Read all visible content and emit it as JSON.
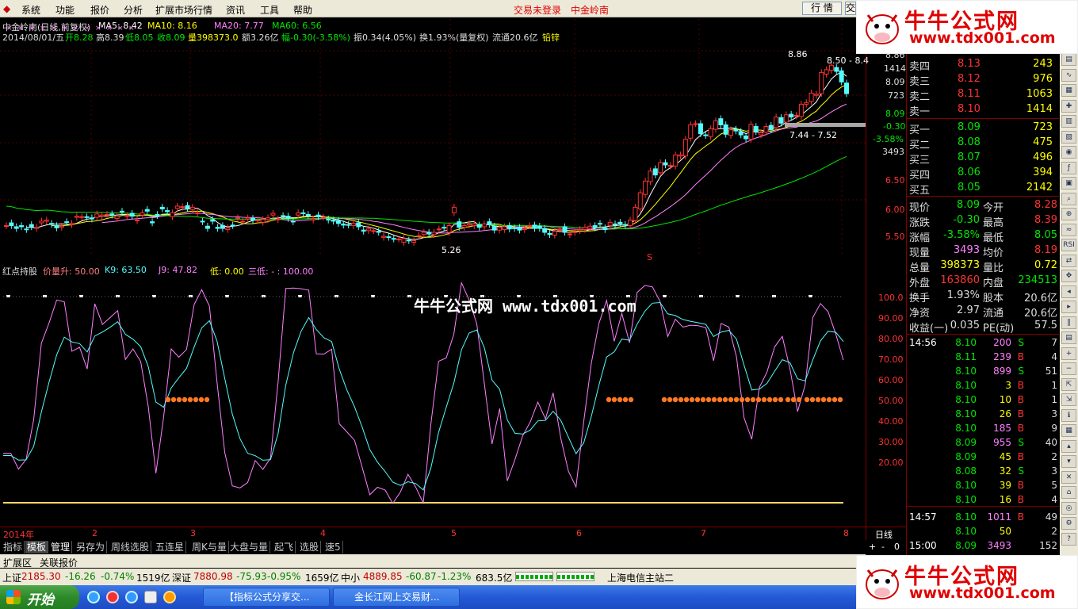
{
  "menubar": {
    "items": [
      "系统",
      "功能",
      "报价",
      "分析",
      "扩展市场行情",
      "资讯",
      "工具",
      "帮助"
    ],
    "center": [
      "交易未登录",
      "中金岭南"
    ],
    "dock_button": "行 情"
  },
  "chart": {
    "header1": [
      "中金岭南(日线,前复权)",
      "MA5: 8.42",
      "MA10: 8.16",
      "MA20: 7.77",
      "MA60: 6.56"
    ],
    "header2": [
      "2014/08/01/五",
      "开8.28",
      "高8.39",
      "低8.05",
      "收8.09",
      "量398373.0",
      "额3.26亿",
      "幅-0.30(-3.58%)",
      "振0.34(4.05%)",
      "换1.93%(量复权)",
      "流通20.6亿",
      "铅锌"
    ],
    "price_axis": [
      "8.86",
      "1414",
      "8.09",
      "723",
      "8.09",
      "-0.30",
      "-3.58%",
      "3493",
      "6.50",
      "6.00",
      "5.50"
    ],
    "annotations": [
      "8.86",
      "8.50 - 8.4",
      "7.44 - 7.52",
      "5.26",
      "S"
    ],
    "ind_header": [
      "红点持股",
      "价量升: 50.00",
      "K9: 63.50",
      "J9: 47.82",
      "低: 0.00",
      "三低: - : 100.00"
    ],
    "ind_axis": [
      "100.0",
      "90.00",
      "80.00",
      "70.00",
      "60.00",
      "50.00",
      "40.00",
      "30.00",
      "20.00"
    ],
    "x_axis": [
      "2014年",
      "2",
      "3",
      "4",
      "5",
      "6",
      "7",
      "8"
    ],
    "period": "日线",
    "zoom": [
      "+",
      "-",
      "0"
    ],
    "watermark": "牛牛公式网 www.tdx001.com",
    "candles": {
      "o": [
        5.72,
        5.77,
        5.7,
        5.72,
        5.66,
        5.74,
        5.67,
        5.77,
        5.8,
        5.76,
        5.72,
        5.69,
        5.79,
        5.74,
        5.87,
        5.87,
        5.88,
        5.86,
        5.87,
        5.89,
        5.92,
        5.93,
        5.85,
        5.98,
        5.89,
        5.94,
        5.81,
        5.91,
        6.01,
        5.79,
        5.92,
        6.05,
        5.99,
        5.88,
        6.03,
        6.05,
        6.08,
        6.01,
        5.94,
        5.8,
        5.71,
        5.83,
        5.69,
        5.72,
        5.65,
        5.73,
        5.85,
        5.8,
        5.84,
        5.85,
        5.81,
        5.78,
        5.83,
        5.91,
        5.83,
        5.9,
        5.89,
        5.8,
        5.91,
        5.95,
        5.92,
        5.82,
        5.91,
        5.87,
        5.84,
        5.82,
        5.81,
        5.75,
        5.74,
        5.72,
        5.77,
        5.64,
        5.63,
        5.63,
        5.62,
        5.51,
        5.52,
        5.49,
        5.48,
        5.42,
        5.46,
        5.42,
        5.54,
        5.56,
        5.6,
        5.56,
        5.66,
        5.69,
        5.6,
        5.95,
        5.79,
        5.69,
        5.73,
        5.72,
        5.73,
        5.7,
        5.79,
        5.71,
        5.64,
        5.65,
        5.72,
        5.68,
        5.69,
        5.65,
        5.72,
        5.73,
        5.71,
        5.67,
        5.58,
        5.55,
        5.65,
        5.7,
        5.56,
        5.6,
        5.63,
        5.65,
        5.67,
        5.72,
        5.76,
        5.68,
        5.72,
        5.75,
        5.78,
        5.74,
        5.72,
        5.81,
        6.02,
        6.28,
        6.51,
        6.74,
        6.67,
        6.85,
        6.79,
        6.79,
        6.97,
        6.97,
        7.29,
        7.55,
        7.55,
        7.35,
        7.32,
        7.45,
        7.64,
        7.53,
        7.34,
        7.45,
        7.41,
        7.33,
        7.27,
        7.5,
        7.35,
        7.4,
        7.52,
        7.48,
        7.66,
        7.58,
        7.72,
        7.69,
        7.68,
        7.9,
        7.95,
        8.06,
        8.09,
        8.44,
        8.51,
        8.56,
        8.5,
        8.28
      ],
      "c": [
        5.72,
        5.72,
        5.67,
        5.7,
        5.65,
        5.7,
        5.69,
        5.8,
        5.82,
        5.74,
        5.68,
        5.71,
        5.78,
        5.76,
        5.89,
        5.88,
        5.87,
        5.84,
        5.93,
        5.91,
        5.92,
        5.91,
        5.89,
        5.97,
        5.9,
        5.89,
        5.82,
        5.95,
        5.98,
        5.77,
        5.9,
        6.02,
        5.97,
        5.95,
        6.07,
        6.06,
        6.03,
        6.05,
        5.95,
        5.79,
        5.67,
        5.8,
        5.67,
        5.67,
        5.68,
        5.72,
        5.86,
        5.8,
        5.86,
        5.82,
        5.82,
        5.83,
        5.86,
        5.94,
        5.84,
        5.89,
        5.85,
        5.79,
        5.95,
        5.94,
        5.9,
        5.84,
        5.88,
        5.87,
        5.82,
        5.8,
        5.76,
        5.73,
        5.73,
        5.76,
        5.7,
        5.62,
        5.66,
        5.63,
        5.6,
        5.53,
        5.51,
        5.48,
        5.48,
        5.49,
        5.45,
        5.45,
        5.54,
        5.6,
        5.57,
        5.6,
        5.66,
        5.68,
        5.72,
        6.05,
        5.69,
        5.72,
        5.75,
        5.75,
        5.69,
        5.75,
        5.74,
        5.64,
        5.69,
        5.7,
        5.66,
        5.67,
        5.64,
        5.67,
        5.72,
        5.67,
        5.67,
        5.6,
        5.56,
        5.62,
        5.65,
        5.6,
        5.57,
        5.61,
        5.65,
        5.69,
        5.71,
        5.68,
        5.75,
        5.65,
        5.78,
        5.73,
        5.75,
        5.73,
        5.82,
        6.05,
        6.31,
        6.52,
        6.7,
        6.63,
        6.85,
        6.81,
        6.8,
        6.99,
        6.99,
        7.27,
        7.53,
        7.55,
        7.37,
        7.34,
        7.46,
        7.6,
        7.53,
        7.36,
        7.44,
        7.42,
        7.35,
        7.28,
        7.54,
        7.41,
        7.39,
        7.5,
        7.44,
        7.67,
        7.56,
        7.71,
        7.67,
        7.7,
        7.9,
        7.93,
        8.1,
        8.08,
        8.47,
        8.52,
        8.6,
        8.49,
        8.3,
        8.09
      ]
    },
    "ind_series": {
      "pink": [
        24.0,
        24.0,
        16.3,
        21.0,
        40.3,
        77.4,
        87.1,
        98.3,
        97.5,
        73.5,
        75.4,
        64.9,
        96.5,
        86.5,
        89.8,
        93.2,
        69.5,
        74.6,
        68.5,
        46.5,
        14.3,
        41.5,
        74.6,
        70.6,
        74.3,
        96.1,
        103.3,
        95.4,
        58.5,
        24.5,
        8.2,
        7.2,
        9.8,
        20.5,
        16.2,
        21.6,
        58.9,
        103.9,
        104.1,
        103.8,
        103.1,
        72.2,
        72.1,
        74.5,
        38.3,
        34.4,
        30.3,
        17.2,
        3.9,
        7.5,
        6.2,
        -0.3,
        5.2,
        13.8,
        7.6,
        -0.1,
        38.2,
        68.6,
        70.2,
        81.7,
        106.7,
        98.4,
        86.8,
        57.7,
        28.5,
        45.7,
        10.6,
        20.9,
        32.4,
        39.1,
        48.8,
        40.7,
        53.3,
        31.3,
        15.3,
        7.7,
        39.3,
        67.7,
        87.0,
        98.1,
        78.3,
        91.8,
        77.6,
        102.0,
        105.4,
        104.7,
        97.7,
        80.6,
        89.0,
        85.2,
        86.1,
        85.9,
        84.9,
        68.9,
        87.0,
        85.2,
        70.9,
        41.2,
        30.8,
        55.9,
        63.4,
        75.6,
        80.7,
        65.2,
        44.2,
        57.2,
        89.9,
        96.6,
        92.7,
        81.8,
        69.2
      ],
      "cyan": [
        22.9,
        22.9,
        20.7,
        20.8,
        27.3,
        44.0,
        58.4,
        71.7,
        80.3,
        78.0,
        77.2,
        73.1,
        80.9,
        82.8,
        85.1,
        87.8,
        81.7,
        79.3,
        75.7,
        66.0,
        48.8,
        46.3,
        55.7,
        60.6,
        65.2,
        75.5,
        84.8,
        88.3,
        78.4,
        60.4,
        43.0,
        31.1,
        24.0,
        22.8,
        20.6,
        20.9,
        33.6,
        57.0,
        72.7,
        83.1,
        89.8,
        84.0,
        80.0,
        78.2,
        64.9,
        54.7,
        46.5,
        36.7,
        25.8,
        19.7,
        15.2,
        10.0,
        8.4,
        10.2,
        9.3,
        6.2,
        16.9,
        34.1,
        46.2,
        58.0,
        74.2,
        82.3,
        83.8,
        75.1,
        59.5,
        55.0,
        40.2,
        33.7,
        33.3,
        35.2,
        39.7,
        40.0,
        44.4,
        40.0,
        31.8,
        23.8,
        29.0,
        41.9,
        57.0,
        70.7,
        73.2,
        79.4,
        78.8,
        86.6,
        92.9,
        96.8,
        97.1,
        91.6,
        90.8,
        88.9,
        88.0,
        87.3,
        86.5,
        80.6,
        82.8,
        83.6,
        79.4,
        66.7,
        54.7,
        55.1,
        57.9,
        63.8,
        69.4,
        68.0,
        60.1,
        59.1,
        69.4,
        78.5,
        83.2,
        82.7,
        78.2
      ]
    }
  },
  "quote": {
    "asks": [
      {
        "label": "卖四",
        "price": "8.13",
        "vol": "243"
      },
      {
        "label": "卖三",
        "price": "8.12",
        "vol": "976"
      },
      {
        "label": "卖二",
        "price": "8.11",
        "vol": "1063"
      },
      {
        "label": "卖一",
        "price": "8.10",
        "vol": "1414"
      }
    ],
    "bids": [
      {
        "label": "买一",
        "price": "8.09",
        "vol": "723"
      },
      {
        "label": "买二",
        "price": "8.08",
        "vol": "475"
      },
      {
        "label": "买三",
        "price": "8.07",
        "vol": "496"
      },
      {
        "label": "买四",
        "price": "8.06",
        "vol": "394"
      },
      {
        "label": "买五",
        "price": "8.05",
        "vol": "2142"
      }
    ],
    "stats": [
      [
        "现价",
        "8.09",
        "今开",
        "8.28"
      ],
      [
        "涨跌",
        "-0.30",
        "最高",
        "8.39"
      ],
      [
        "涨幅",
        "-3.58%",
        "最低",
        "8.05"
      ],
      [
        "现量",
        "3493",
        "均价",
        "8.19"
      ],
      [
        "总量",
        "398373",
        "量比",
        "0.72"
      ],
      [
        "外盘",
        "163860",
        "内盘",
        "234513"
      ],
      [
        "换手",
        "1.93%",
        "股本",
        "20.6亿"
      ],
      [
        "净资",
        "2.97",
        "流通",
        "20.6亿"
      ],
      [
        "收益(一)",
        "0.035",
        "PE(动)",
        "57.5"
      ]
    ]
  },
  "ticks": [
    [
      "14:56",
      "8.10",
      "200",
      "S",
      "7"
    ],
    [
      "",
      "8.11",
      "239",
      "B",
      "4"
    ],
    [
      "",
      "8.10",
      "899",
      "S",
      "51"
    ],
    [
      "",
      "8.10",
      "3",
      "B",
      "1"
    ],
    [
      "",
      "8.10",
      "10",
      "B",
      "1"
    ],
    [
      "",
      "8.10",
      "26",
      "B",
      "3"
    ],
    [
      "",
      "8.10",
      "185",
      "B",
      "9"
    ],
    [
      "",
      "8.09",
      "955",
      "S",
      "40"
    ],
    [
      "",
      "8.09",
      "45",
      "B",
      "2"
    ],
    [
      "",
      "8.08",
      "32",
      "S",
      "3"
    ],
    [
      "",
      "8.10",
      "39",
      "B",
      "5"
    ],
    [
      "",
      "8.10",
      "16",
      "B",
      "4"
    ],
    [
      "14:57",
      "8.10",
      "1011",
      "B",
      "49"
    ],
    [
      "",
      "8.10",
      "50",
      "",
      "2"
    ],
    [
      "15:00",
      "8.09",
      "3493",
      "",
      "152"
    ]
  ],
  "tabs": [
    "指标",
    "模板",
    "管理",
    "另存为",
    "周线选股",
    "五连星",
    "周K与量",
    "大盘与量",
    "起飞",
    "选股",
    "速5"
  ],
  "ext": [
    "扩展区",
    "关联报价"
  ],
  "status": {
    "sh": [
      "上证",
      "2185.30",
      "-16.26",
      "-0.74%",
      "1519亿"
    ],
    "sz": [
      "深证",
      "7880.98",
      "-75.93",
      "-0.95%",
      "1659亿"
    ],
    "zx": [
      "中小",
      "4889.85",
      "-60.87",
      "-1.23%",
      "683.5亿"
    ],
    "server": "上海电信主站二"
  },
  "taskbar": {
    "start": "开始",
    "tasks": [
      "【指标公式分享交...",
      "金长江网上交易财..."
    ]
  },
  "ad": {
    "title": "牛牛公式网",
    "url": "www.tdx001.com"
  },
  "toolbar": {
    "labels": [
      "RSI"
    ]
  },
  "colors": {
    "up": "#ff3232",
    "down": "#54fcfc",
    "ma5": "#ffffff",
    "ma10": "#ffff00",
    "ma20": "#ff80ff",
    "ma60": "#00e600",
    "frame": "#800000"
  }
}
